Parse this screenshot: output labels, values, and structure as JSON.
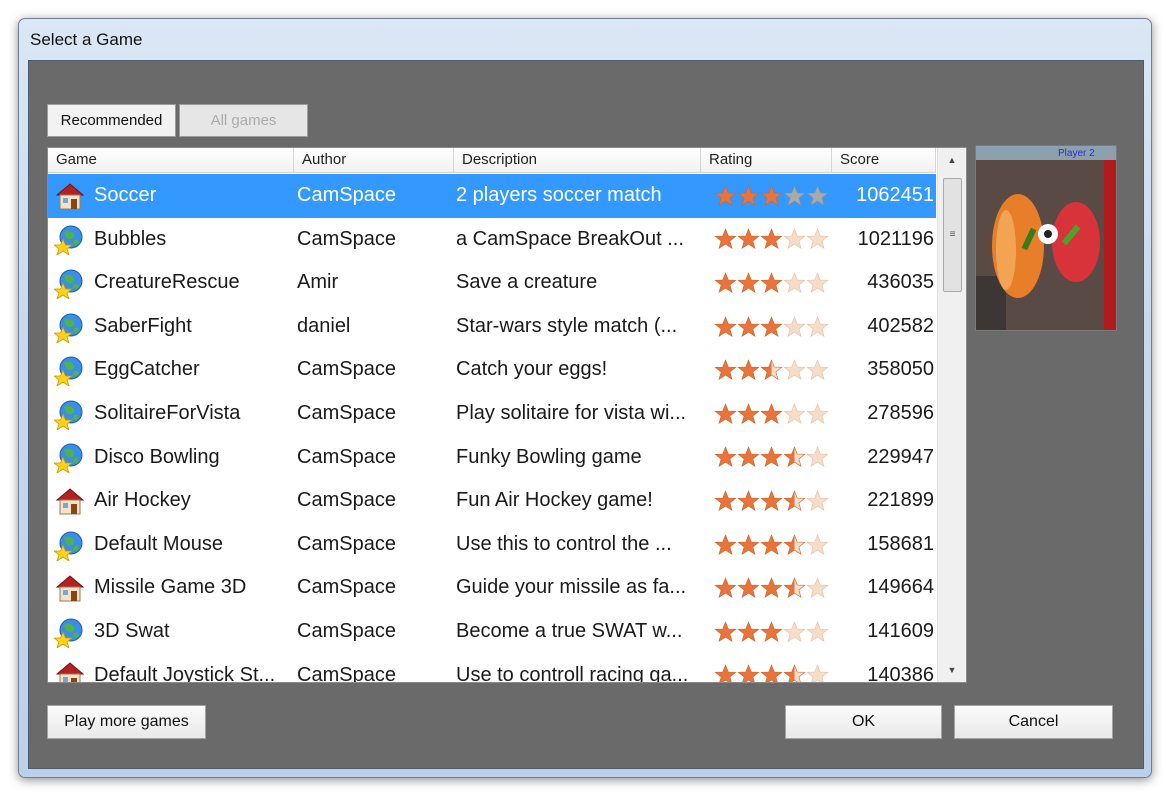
{
  "window": {
    "title": "Select a Game"
  },
  "tabs": {
    "recommended": "Recommended",
    "all": "All games"
  },
  "columns": {
    "game": "Game",
    "author": "Author",
    "description": "Description",
    "rating": "Rating",
    "score": "Score"
  },
  "games": [
    {
      "icon": "house-icon",
      "name": "Soccer",
      "author": "CamSpace",
      "description": "2 players soccer match",
      "rating": 3,
      "score": "1062451",
      "selected": true
    },
    {
      "icon": "globe-star-icon",
      "name": "Bubbles",
      "author": "CamSpace",
      "description": "a CamSpace BreakOut ...",
      "rating": 3,
      "score": "1021196"
    },
    {
      "icon": "globe-star-icon",
      "name": "CreatureRescue",
      "author": "Amir",
      "description": "Save a creature",
      "rating": 3,
      "score": "436035"
    },
    {
      "icon": "globe-star-icon",
      "name": "SaberFight",
      "author": "daniel",
      "description": "Star-wars style match (...",
      "rating": 3,
      "score": "402582"
    },
    {
      "icon": "globe-star-icon",
      "name": "EggCatcher",
      "author": "CamSpace",
      "description": "Catch your eggs!",
      "rating": 2.5,
      "score": "358050"
    },
    {
      "icon": "globe-star-icon",
      "name": "SolitaireForVista",
      "author": "CamSpace",
      "description": "Play solitaire for vista wi...",
      "rating": 3,
      "score": "278596"
    },
    {
      "icon": "globe-star-icon",
      "name": "Disco Bowling",
      "author": "CamSpace",
      "description": "Funky Bowling game",
      "rating": 3.5,
      "score": "229947"
    },
    {
      "icon": "house-icon",
      "name": "Air Hockey",
      "author": "CamSpace",
      "description": "Fun Air Hockey game!",
      "rating": 3.5,
      "score": "221899"
    },
    {
      "icon": "globe-star-icon",
      "name": "Default Mouse",
      "author": "CamSpace",
      "description": "Use this to control the ...",
      "rating": 3.5,
      "score": "158681"
    },
    {
      "icon": "house-icon",
      "name": "Missile Game 3D",
      "author": "CamSpace",
      "description": "Guide your missile as fa...",
      "rating": 3.5,
      "score": "149664"
    },
    {
      "icon": "globe-star-icon",
      "name": "3D Swat",
      "author": "CamSpace",
      "description": "Become a true SWAT w...",
      "rating": 3,
      "score": "141609"
    },
    {
      "icon": "house-icon",
      "name": "Default Joystick St...",
      "author": "CamSpace",
      "description": "Use to controll racing ga...",
      "rating": 3.5,
      "score": "140386"
    }
  ],
  "preview": {
    "label": "Player 2"
  },
  "buttons": {
    "play_more": "Play more games",
    "ok": "OK",
    "cancel": "Cancel"
  },
  "colors": {
    "selection": "#3399ff",
    "star_full": "#e8743b",
    "star_empty": "#f6ddc8",
    "star_gray": "#a9a9a9",
    "client_bg": "#6a6a6a"
  }
}
